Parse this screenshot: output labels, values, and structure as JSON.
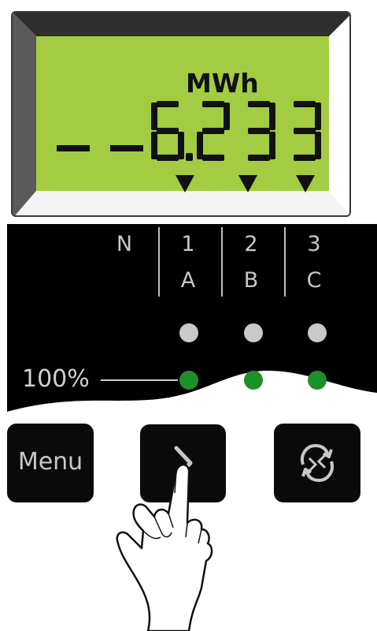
{
  "display": {
    "unit": "MWh",
    "reading": "6.233",
    "leading_segments": "-- --",
    "indicator_arrows": 3
  },
  "phases": {
    "labels": [
      {
        "top": "N",
        "bottom": ""
      },
      {
        "top": "1",
        "bottom": "A"
      },
      {
        "top": "2",
        "bottom": "B"
      },
      {
        "top": "3",
        "bottom": "C"
      }
    ]
  },
  "leds": {
    "top_row": [
      "grey",
      "grey",
      "grey"
    ],
    "bottom_row": [
      "green",
      "green",
      "green"
    ],
    "threshold_label": "100%"
  },
  "buttons": {
    "menu_label": "Menu",
    "next_icon": "chevron-right-icon",
    "cycle_icon": "cycle-arrows-icon"
  },
  "colors": {
    "lcd_background": "#a3cc43",
    "panel_background": "#000000",
    "led_green": "#1f8f2a",
    "led_grey": "#c9c9c9"
  }
}
